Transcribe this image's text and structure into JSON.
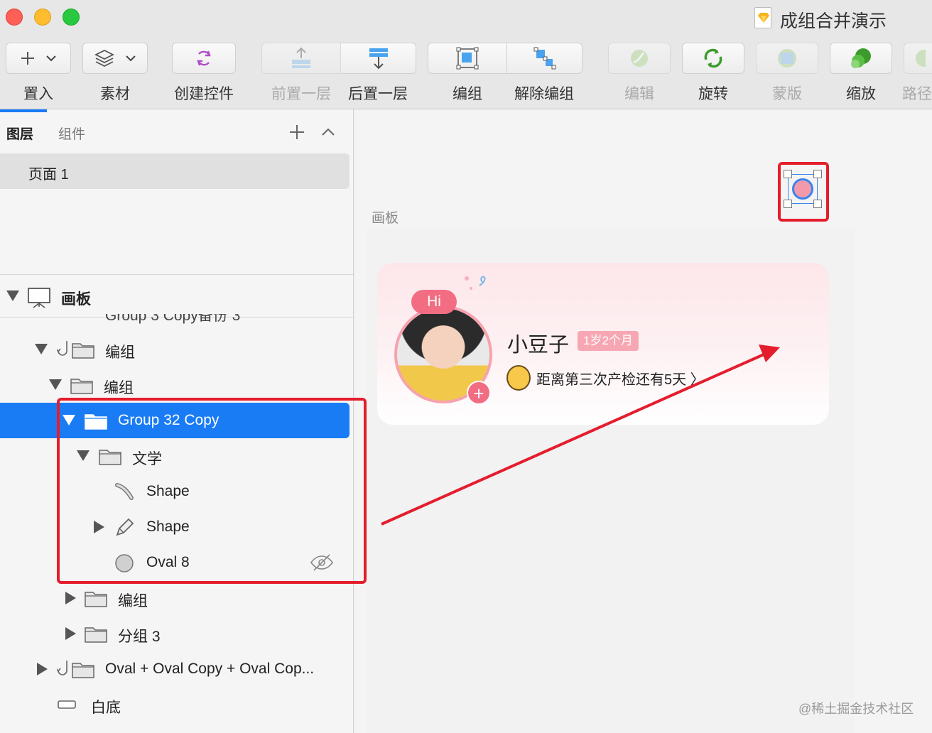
{
  "window": {
    "title": "成组合并演示"
  },
  "toolbar": {
    "insert": "置入",
    "assets": "素材",
    "create_symbol": "创建控件",
    "forward": "前置一层",
    "backward": "后置一层",
    "group": "编组",
    "ungroup": "解除编组",
    "edit": "编辑",
    "rotate": "旋转",
    "mask": "蒙版",
    "scale": "缩放",
    "path": "路径"
  },
  "panel": {
    "tab_layers": "图层",
    "tab_components": "组件",
    "page": "页面 1",
    "artboard": "画板",
    "clipped_row": "Group 3 Copy备份 3",
    "layers": {
      "group_a": "编组",
      "group_b": "编组",
      "selected": "Group 32 Copy",
      "wenxue": "文学",
      "shape1": "Shape",
      "shape2": "Shape",
      "oval8": "Oval 8",
      "group_c": "编组",
      "group3": "分组 3",
      "ovals": "Oval + Oval Copy + Oval Cop...",
      "white_bg": "白底"
    }
  },
  "canvas": {
    "artboard_label": "画板",
    "card": {
      "hi": "Hi",
      "name": "小豆子",
      "age": "1岁2个月",
      "countdown": "距离第三次产检还有5天 〉",
      "plus": "+"
    }
  },
  "colors": {
    "accent": "#1a7cf5",
    "highlight_red": "#e41d2d",
    "pink": "#f36d82"
  },
  "watermark": "@稀土掘金技术社区"
}
